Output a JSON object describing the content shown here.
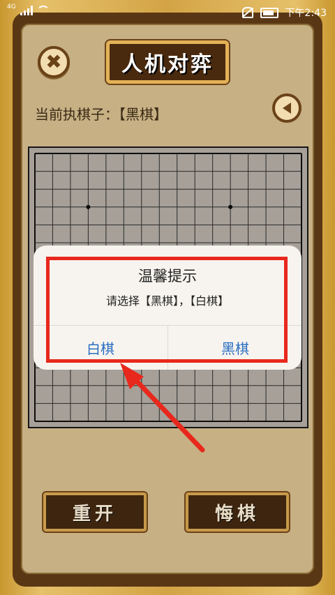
{
  "status_bar": {
    "network": "4G",
    "time": "下午2:43"
  },
  "header": {
    "title": "人机对弈",
    "close_icon": "close-icon",
    "sound_icon": "speaker-icon"
  },
  "turn": {
    "label": "当前执棋子：【黑棋】"
  },
  "board": {
    "size": 15
  },
  "dialog": {
    "title": "温馨提示",
    "message": "请选择【黑棋】，【白棋】",
    "buttons": [
      {
        "label": "白棋"
      },
      {
        "label": "黑棋"
      }
    ]
  },
  "actions": {
    "restart_label": "重开",
    "undo_label": "悔棋"
  },
  "colors": {
    "accent_button_text": "#2b6fc2",
    "highlight_red": "#e8281c"
  }
}
